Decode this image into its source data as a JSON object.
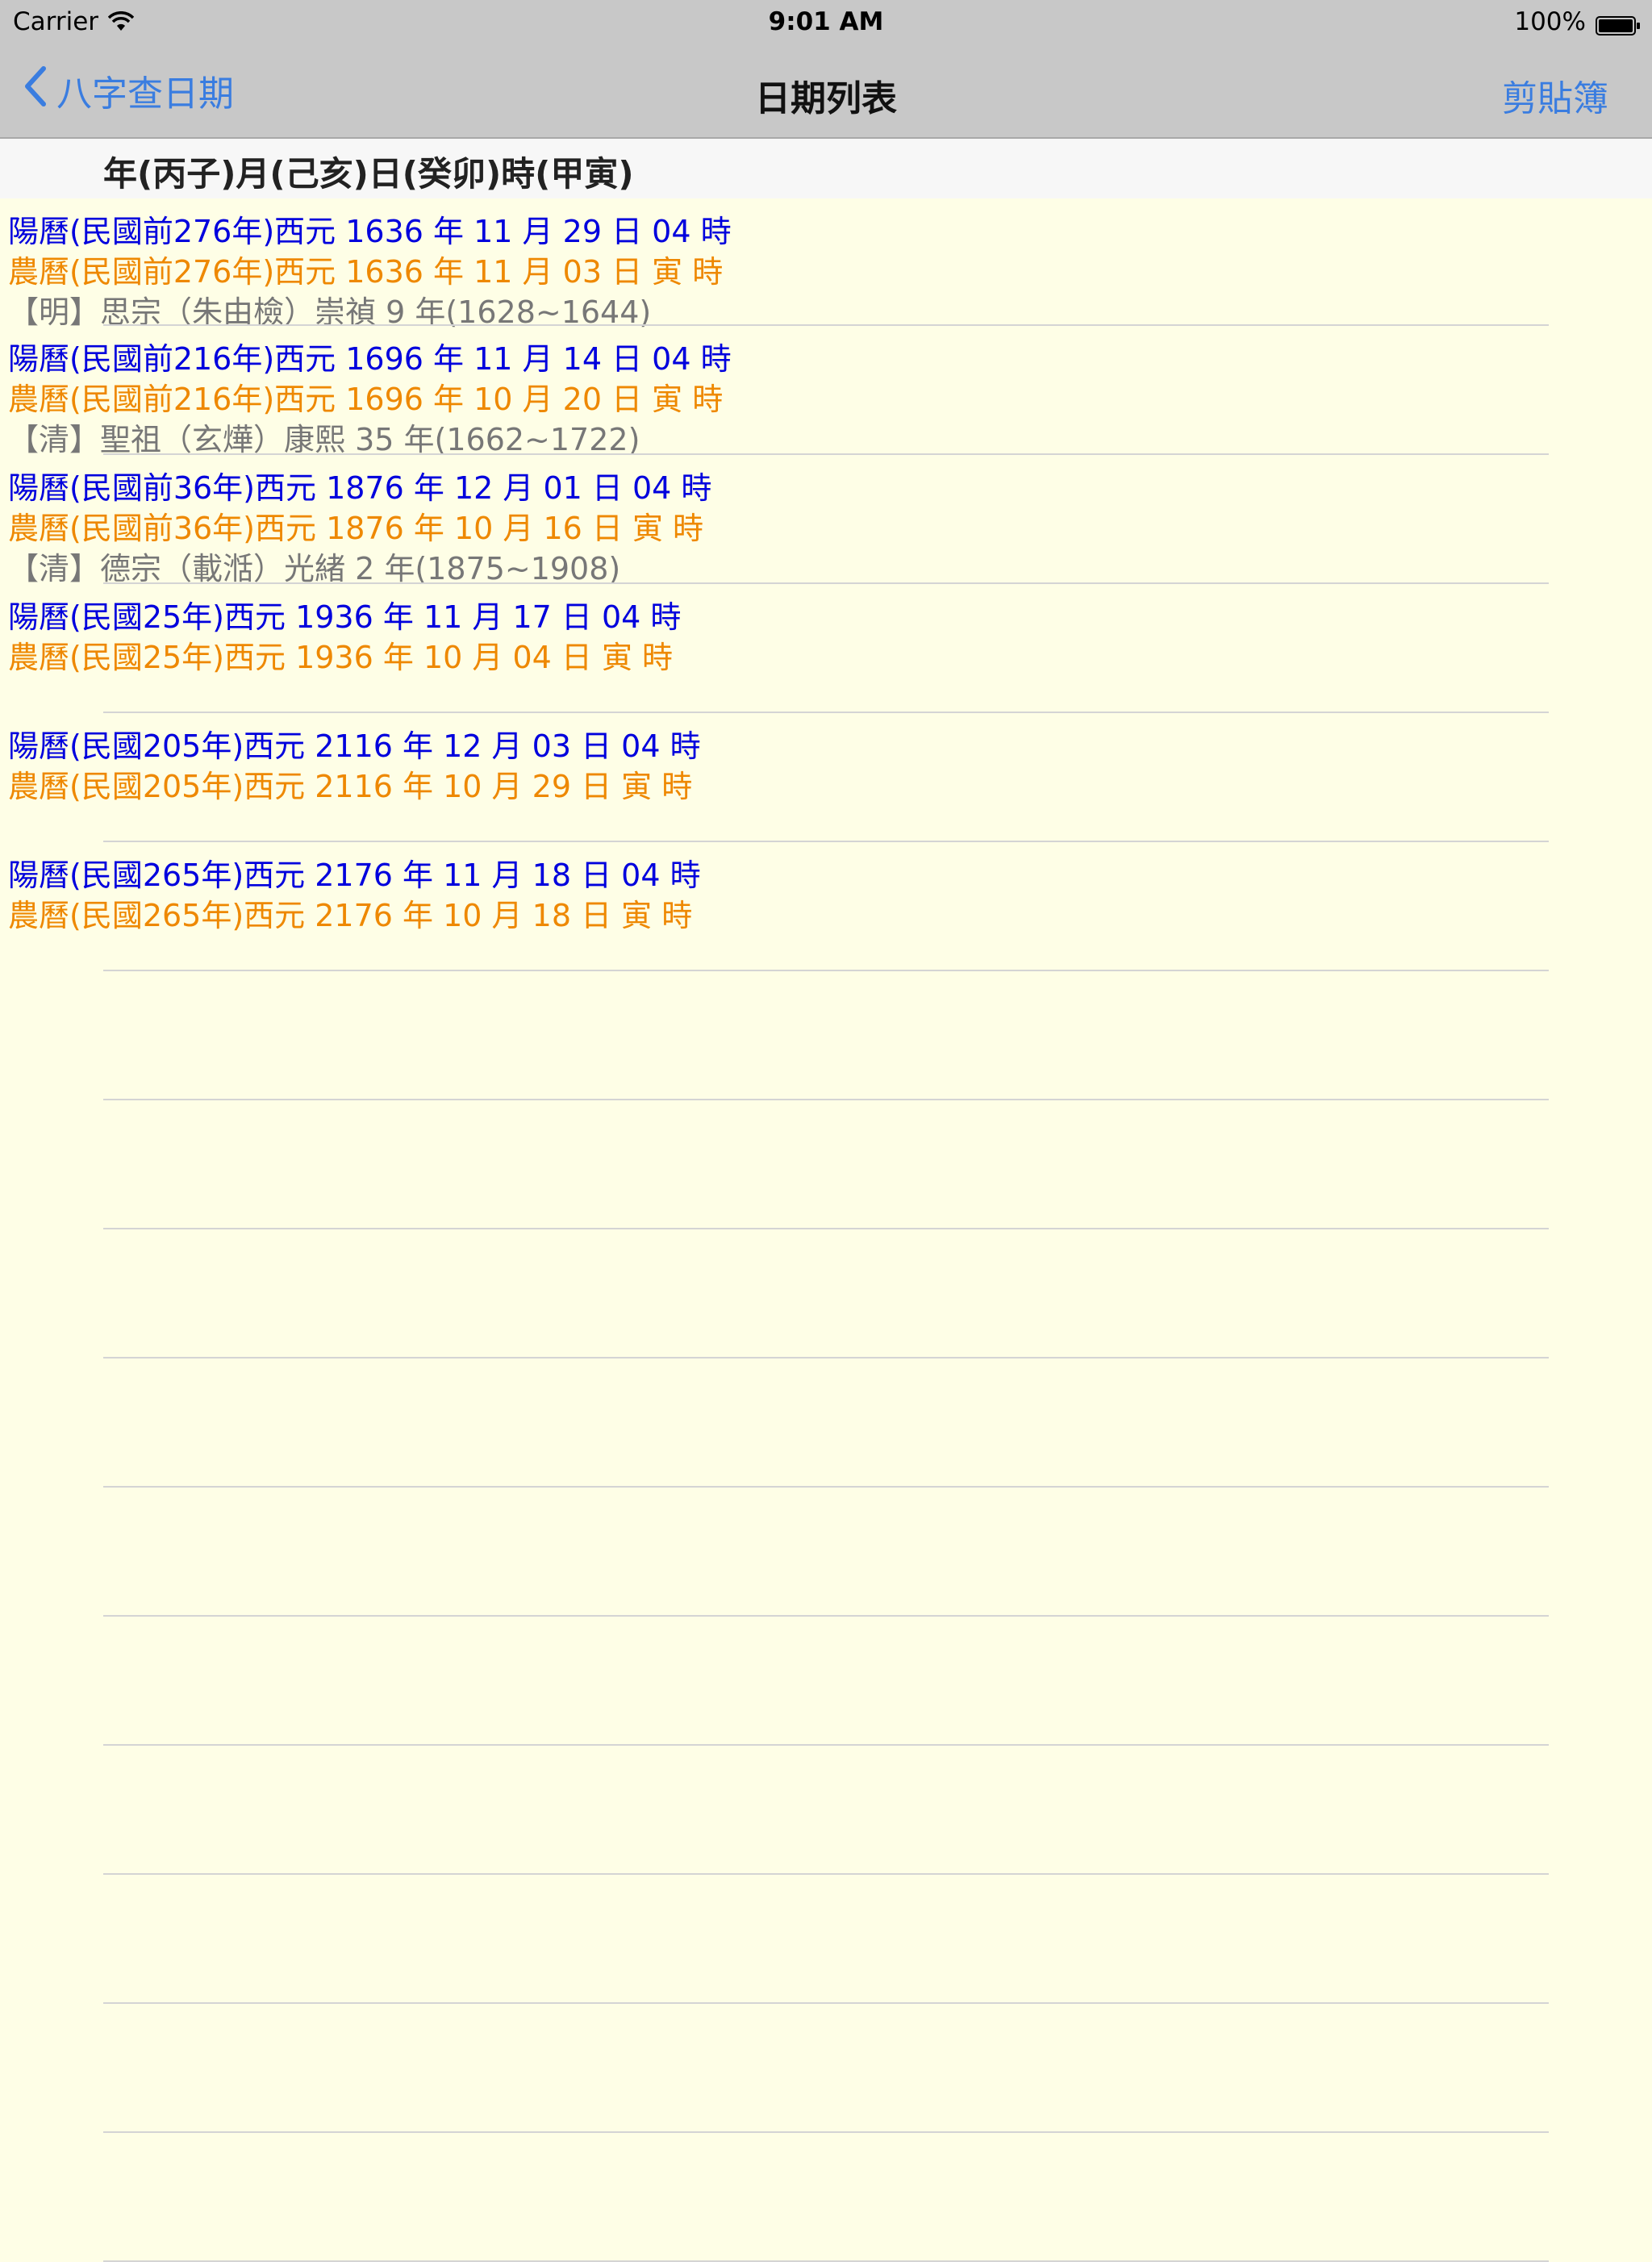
{
  "status_bar": {
    "carrier": "Carrier",
    "time": "9:01 AM",
    "battery": "100%"
  },
  "nav": {
    "back_label": "八字查日期",
    "title": "日期列表",
    "right_label": "剪貼簿"
  },
  "header": {
    "text": "年(丙子)月(己亥)日(癸卯)時(甲寅)"
  },
  "colors": {
    "solar": "#0000dd",
    "lunar": "#ee8800",
    "era": "#777777",
    "accent": "#3a7de0",
    "background": "#fefee6"
  },
  "rows": [
    {
      "solar": "陽曆(民國前276年)西元 1636 年 11 月 29 日 04 時",
      "lunar": "農曆(民國前276年)西元 1636 年 11 月 03 日 寅 時",
      "era": "【明】思宗（朱由檢）崇禎 9 年(1628~1644)"
    },
    {
      "solar": "陽曆(民國前216年)西元 1696 年 11 月 14 日 04 時",
      "lunar": "農曆(民國前216年)西元 1696 年 10 月 20 日 寅 時",
      "era": "【清】聖祖（玄燁）康熙 35 年(1662~1722)"
    },
    {
      "solar": "陽曆(民國前36年)西元 1876 年 12 月 01 日 04 時",
      "lunar": "農曆(民國前36年)西元 1876 年 10 月 16 日 寅 時",
      "era": "【清】德宗（載湉）光緒 2 年(1875~1908)"
    },
    {
      "solar": "陽曆(民國25年)西元 1936 年 11 月 17 日 04 時",
      "lunar": "農曆(民國25年)西元 1936 年 10 月 04 日 寅 時",
      "era": ""
    },
    {
      "solar": "陽曆(民國205年)西元 2116 年 12 月 03 日 04 時",
      "lunar": "農曆(民國205年)西元 2116 年 10 月 29 日 寅 時",
      "era": ""
    },
    {
      "solar": "陽曆(民國265年)西元 2176 年 11 月 18 日 04 時",
      "lunar": "農曆(民國265年)西元 2176 年 10 月 18 日 寅 時",
      "era": ""
    },
    {
      "solar": "",
      "lunar": "",
      "era": ""
    },
    {
      "solar": "",
      "lunar": "",
      "era": ""
    },
    {
      "solar": "",
      "lunar": "",
      "era": ""
    },
    {
      "solar": "",
      "lunar": "",
      "era": ""
    },
    {
      "solar": "",
      "lunar": "",
      "era": ""
    },
    {
      "solar": "",
      "lunar": "",
      "era": ""
    },
    {
      "solar": "",
      "lunar": "",
      "era": ""
    },
    {
      "solar": "",
      "lunar": "",
      "era": ""
    },
    {
      "solar": "",
      "lunar": "",
      "era": ""
    },
    {
      "solar": "",
      "lunar": "",
      "era": ""
    }
  ]
}
